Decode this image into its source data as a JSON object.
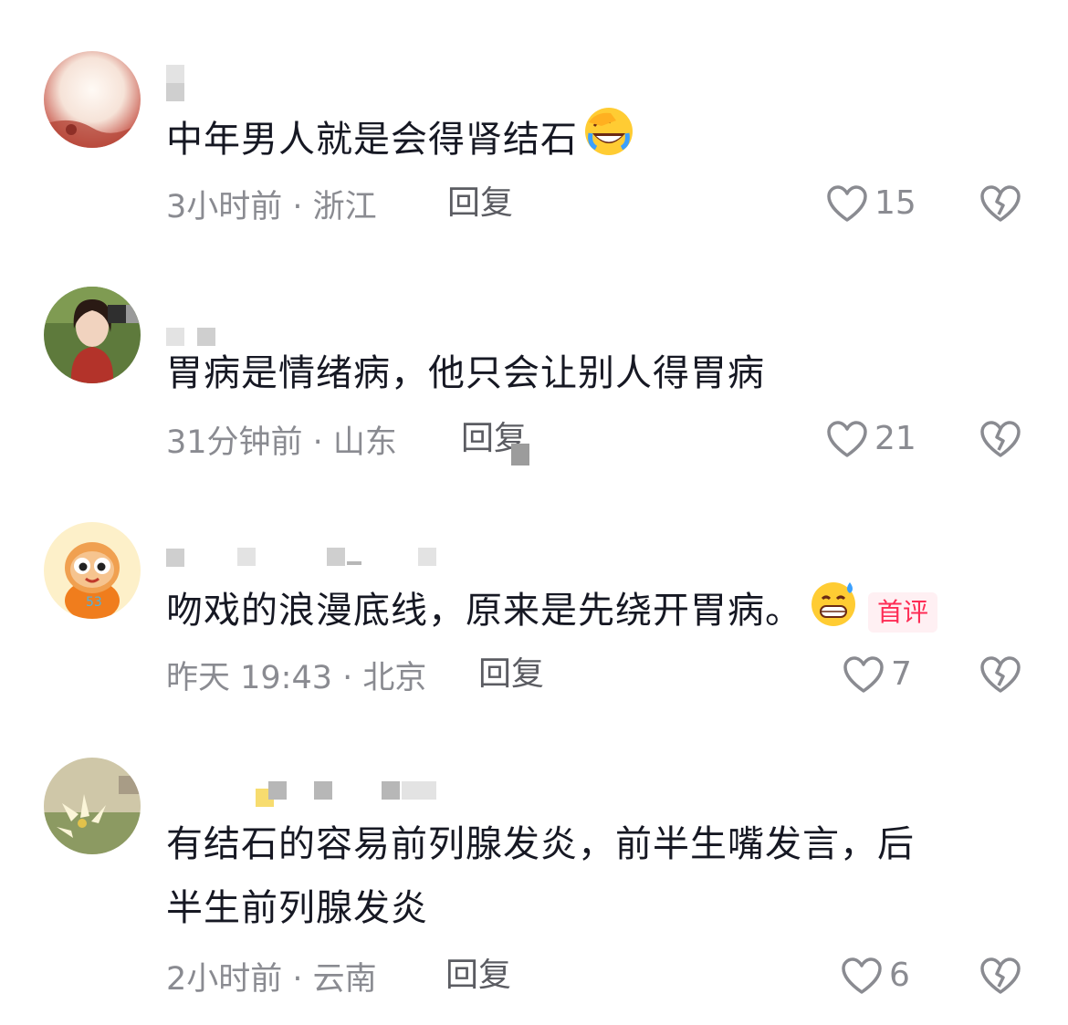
{
  "comments": [
    {
      "text": "中年男人就是会得肾结石",
      "emoji": "facepalm-crying-emoji",
      "time_location": "3小时前 · 浙江",
      "reply_label": "回复",
      "like_count": "15",
      "is_first_comment": false
    },
    {
      "text": "胃病是情绪病，他只会让别人得胃病",
      "time_location": "31分钟前 · 山东",
      "reply_label": "回复",
      "like_count": "21",
      "is_first_comment": false
    },
    {
      "text": "吻戏的浪漫底线，原来是先绕开胃病。",
      "emoji": "grinning-sweat-emoji",
      "badge": "首评",
      "time_location": "昨天 19:43 · 北京",
      "reply_label": "回复",
      "like_count": "7",
      "is_first_comment": true
    },
    {
      "text_line1": "有结石的容易前列腺发炎，前半生嘴发言，后",
      "text_line2": "半生前列腺发炎",
      "time_location": "2小时前 · 云南",
      "reply_label": "回复",
      "like_count": "6",
      "is_first_comment": false
    }
  ],
  "colors": {
    "text_primary": "#161823",
    "text_secondary": "#8a8b91",
    "reply_text": "#5b5c62",
    "badge_text": "#fe2c55",
    "badge_bg": "#fff0f3"
  },
  "icons": {
    "like": "heart-outline-icon",
    "dislike": "broken-heart-icon"
  }
}
